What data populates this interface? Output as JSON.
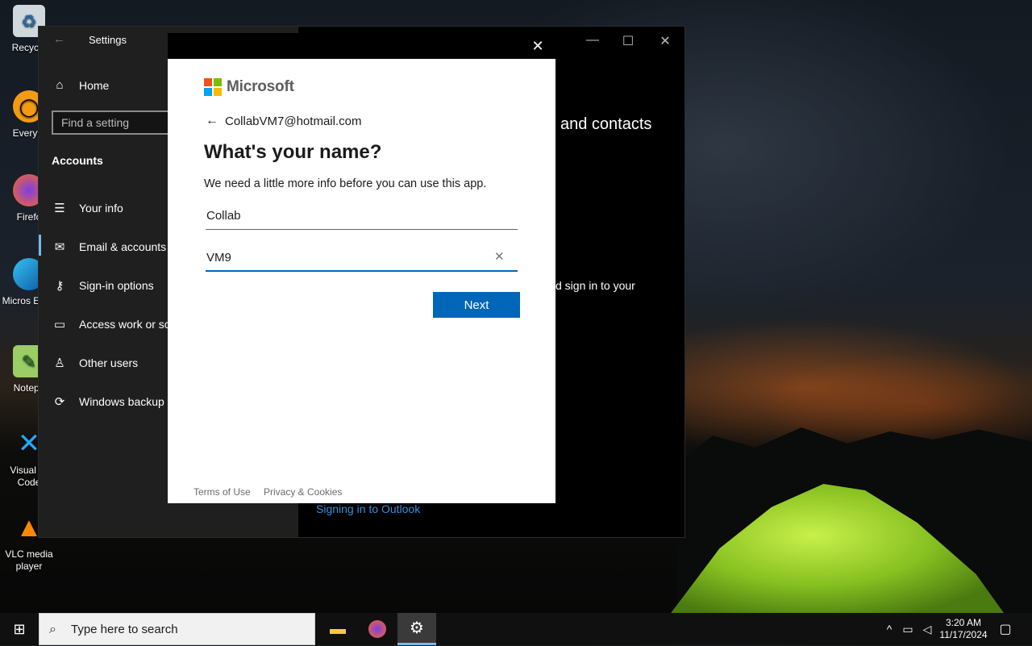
{
  "desktop": {
    "icons": [
      {
        "label": "Recycle",
        "icon": "recycle-bin-icon"
      },
      {
        "label": "Everyth",
        "icon": "everything-search-icon"
      },
      {
        "label": "Firefo",
        "icon": "firefox-icon"
      },
      {
        "label": "Micros Edge",
        "icon": "edge-icon"
      },
      {
        "label": "Notepa",
        "icon": "notepad-plus-icon"
      },
      {
        "label": "Visual St Code",
        "icon": "vscode-icon"
      },
      {
        "label": "VLC media player",
        "icon": "vlc-icon"
      }
    ]
  },
  "settings": {
    "title": "Settings",
    "search_placeholder": "Find a setting",
    "section": "Accounts",
    "home": "Home",
    "nav": [
      {
        "label": "Your info",
        "icon": "person-card-icon"
      },
      {
        "label": "Email & accounts",
        "icon": "mail-icon"
      },
      {
        "label": "Sign-in options",
        "icon": "key-icon"
      },
      {
        "label": "Access work or scl",
        "icon": "briefcase-icon"
      },
      {
        "label": "Other users",
        "icon": "person-add-icon"
      },
      {
        "label": "Windows backup",
        "icon": "sync-icon"
      }
    ],
    "content_heading_fragment": "and contacts",
    "content_text_fragment": "d sign in to your",
    "content_link_fragment": "Signing in to Outlook"
  },
  "dialog": {
    "brand": "Microsoft",
    "account_email": "CollabVM7@hotmail.com",
    "heading": "What's your name?",
    "subtext": "We need a little more info before you can use this app.",
    "first_name_value": "Collab",
    "last_name_value": "VM9",
    "next_label": "Next",
    "terms_label": "Terms of Use",
    "privacy_label": "Privacy & Cookies",
    "logo_colors": [
      "#f25022",
      "#7fba00",
      "#00a4ef",
      "#ffb900"
    ],
    "accent_color": "#0067b8"
  },
  "taskbar": {
    "search_placeholder": "Type here to search",
    "time": "3:20 AM",
    "date": "11/17/2024"
  }
}
